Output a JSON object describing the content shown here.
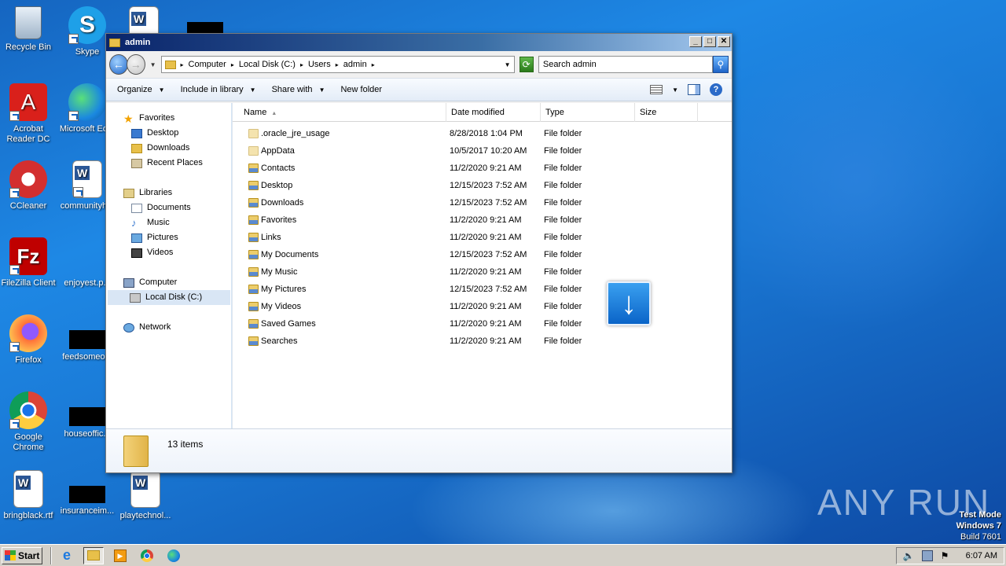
{
  "desktop": {
    "icons": [
      {
        "label": "Recycle Bin",
        "icon": "recycle-bin-icon"
      },
      {
        "label": "Skype",
        "icon": "skype-icon"
      },
      {
        "label": "Acrobat Reader DC",
        "icon": "acrobat-icon"
      },
      {
        "label": "Microsoft Ed...",
        "icon": "edge-icon"
      },
      {
        "label": "CCleaner",
        "icon": "ccleaner-icon"
      },
      {
        "label": "communityh...",
        "icon": "word-doc-icon"
      },
      {
        "label": "FileZilla Client",
        "icon": "filezilla-icon"
      },
      {
        "label": "enjoyest.p...",
        "icon": "file-icon"
      },
      {
        "label": "Firefox",
        "icon": "firefox-icon"
      },
      {
        "label": "feedsomeo...",
        "icon": "file-icon"
      },
      {
        "label": "Google Chrome",
        "icon": "chrome-icon"
      },
      {
        "label": "houseoffic...",
        "icon": "file-icon"
      },
      {
        "label": "bringblack.rtf",
        "icon": "word-doc-icon"
      },
      {
        "label": "insuranceim...",
        "icon": "file-icon"
      },
      {
        "label": "playtechnol...",
        "icon": "word-doc-icon"
      }
    ],
    "watermark": "ANY RUN",
    "test_mode": {
      "line1": "Test Mode",
      "line2": "Windows 7",
      "line3": "Build 7601"
    }
  },
  "window": {
    "title": "admin",
    "address": {
      "crumbs": [
        "Computer",
        "Local Disk (C:)",
        "Users",
        "admin"
      ]
    },
    "search_placeholder": "Search admin",
    "toolbar": {
      "organize": "Organize",
      "include": "Include in library",
      "share": "Share with",
      "new_folder": "New folder"
    },
    "nav": {
      "favorites": "Favorites",
      "desktop": "Desktop",
      "downloads": "Downloads",
      "recent": "Recent Places",
      "libraries": "Libraries",
      "documents": "Documents",
      "music": "Music",
      "pictures": "Pictures",
      "videos": "Videos",
      "computer": "Computer",
      "local_disk": "Local Disk (C:)",
      "network": "Network"
    },
    "columns": {
      "name": "Name",
      "date": "Date modified",
      "type": "Type",
      "size": "Size"
    },
    "files": [
      {
        "name": ".oracle_jre_usage",
        "date": "8/28/2018 1:04 PM",
        "type": "File folder"
      },
      {
        "name": "AppData",
        "date": "10/5/2017 10:20 AM",
        "type": "File folder"
      },
      {
        "name": "Contacts",
        "date": "11/2/2020 9:21 AM",
        "type": "File folder"
      },
      {
        "name": "Desktop",
        "date": "12/15/2023 7:52 AM",
        "type": "File folder"
      },
      {
        "name": "Downloads",
        "date": "12/15/2023 7:52 AM",
        "type": "File folder"
      },
      {
        "name": "Favorites",
        "date": "11/2/2020 9:21 AM",
        "type": "File folder"
      },
      {
        "name": "Links",
        "date": "11/2/2020 9:21 AM",
        "type": "File folder"
      },
      {
        "name": "My Documents",
        "date": "12/15/2023 7:52 AM",
        "type": "File folder"
      },
      {
        "name": "My Music",
        "date": "11/2/2020 9:21 AM",
        "type": "File folder"
      },
      {
        "name": "My Pictures",
        "date": "12/15/2023 7:52 AM",
        "type": "File folder"
      },
      {
        "name": "My Videos",
        "date": "11/2/2020 9:21 AM",
        "type": "File folder"
      },
      {
        "name": "Saved Games",
        "date": "11/2/2020 9:21 AM",
        "type": "File folder"
      },
      {
        "name": "Searches",
        "date": "11/2/2020 9:21 AM",
        "type": "File folder"
      }
    ],
    "status": "13 items"
  },
  "taskbar": {
    "start": "Start",
    "clock": "6:07 AM"
  }
}
